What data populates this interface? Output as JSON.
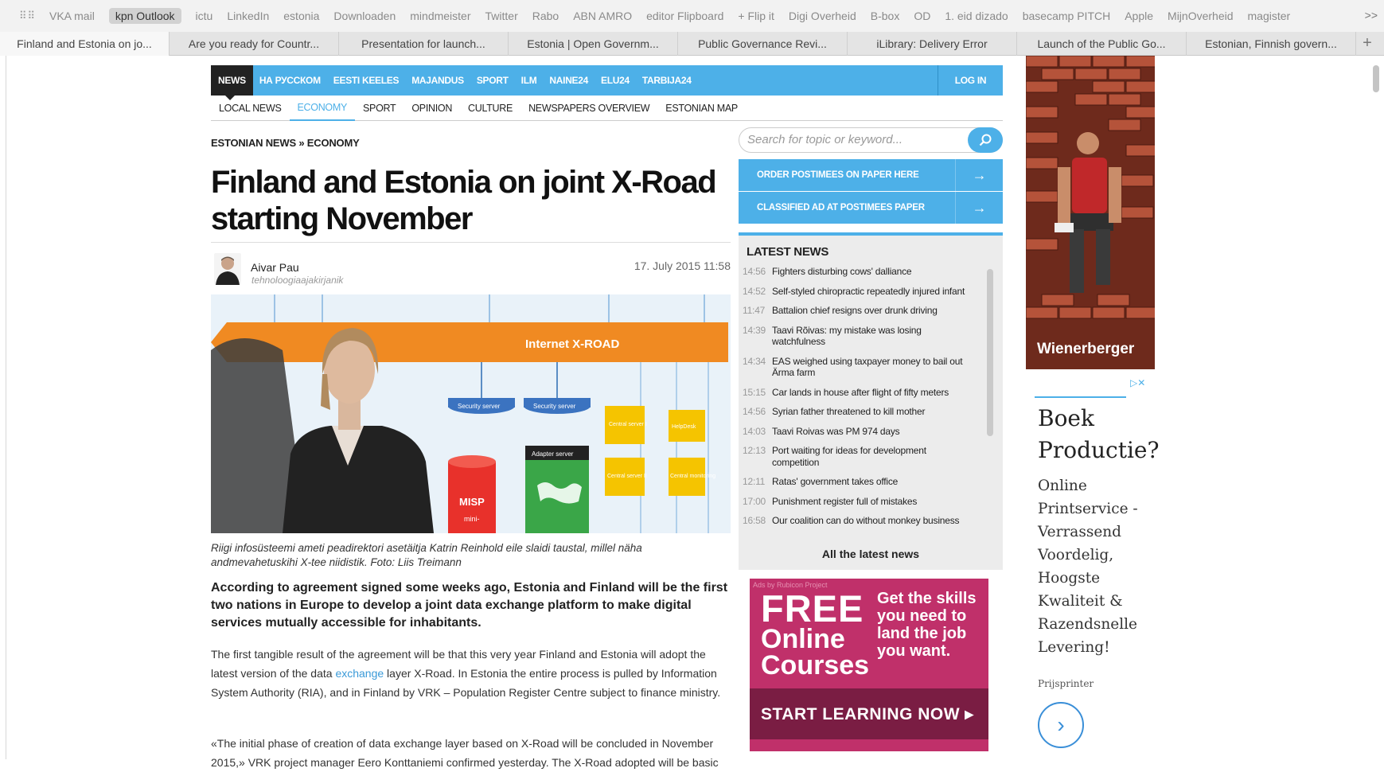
{
  "bookmarks": [
    "VKA mail",
    "kpn Outlook",
    "ictu",
    "LinkedIn",
    "estonia",
    "Downloaden",
    "mindmeister",
    "Twitter",
    "Rabo",
    "ABN AMRO",
    "editor Flipboard",
    "+ Flip it",
    "Digi Overheid",
    "B-box",
    "OD",
    "1. eid dizado",
    "basecamp PITCH",
    "Apple",
    "MijnOverheid",
    "magister"
  ],
  "bookmarks_overflow": ">>",
  "tabs": [
    "Finland and Estonia on jo...",
    "Are you ready for Countr...",
    "Presentation for launch...",
    "Estonia | Open Governm...",
    "Public Governance Revi...",
    "iLibrary: Delivery Error",
    "Launch of the Public Go...",
    "Estonian, Finnish govern..."
  ],
  "tab_add": "+",
  "topnav": {
    "items": [
      "NEWS",
      "НА РУССКОМ",
      "EESTI KEELES",
      "MAJANDUS",
      "SPORT",
      "ILM",
      "NAINE24",
      "ELU24",
      "TARBIJA24"
    ],
    "login": "LOG IN"
  },
  "subnav": [
    "LOCAL NEWS",
    "ECONOMY",
    "SPORT",
    "OPINION",
    "CULTURE",
    "NEWSPAPERS OVERVIEW",
    "ESTONIAN MAP"
  ],
  "breadcrumb": "ESTONIAN NEWS » ECONOMY",
  "article": {
    "title": "Finland and Estonia on joint X-Road starting November",
    "author": "Aivar Pau",
    "author_role": "tehnoloogiaajakirjanik",
    "date": "17. July 2015 11:58",
    "caption": "Riigi infosüsteemi ameti peadirektori asetäitja Katrin Reinhold eile slaidi taustal, millel näha andmevahetuskihi X-tee niidistik. Foto: Liis Treimann",
    "lead": "According to agreement signed some weeks ago, Estonia and Finland will be the first two nations in Europe to develop a joint data exchange platform to make digital services mutually accessible for inhabitants.",
    "p1_a": "The first tangible result of the agreement will be that this very year Finland and Estonia will adopt the latest version of the data ",
    "p1_link": "exchange",
    "p1_b": " layer X-Road. In Estonia the entire process is pulled by Information System Authority (RIA), and in Finland by VRK – Population Register Centre subject to finance ministry.",
    "p2": "«The initial phase of creation of data exchange layer based on X-Road will be concluded in November 2015,» VRK project manager Eero Konttaniemi confirmed yesterday. The X-Road adopted will be basic"
  },
  "hero_labels": {
    "banner": "Internet X-ROAD",
    "security1": "Security server",
    "security2": "Security server",
    "adapter": "Adapter server",
    "misp": "MISP",
    "mini": "mini-",
    "central1": "Central server I",
    "helpdesk": "HelpDesk",
    "central2": "Central server II",
    "monitoring": "Central monitoring"
  },
  "search": {
    "placeholder": "Search for topic or keyword..."
  },
  "cta": [
    "ORDER POSTIMEES ON PAPER HERE",
    "CLASSIFIED AD AT POSTIMEES PAPER"
  ],
  "latest": {
    "heading": "LATEST NEWS",
    "items": [
      {
        "time": "14:56",
        "text": "Fighters disturbing cows' dalliance"
      },
      {
        "time": "14:52",
        "text": "Self-styled chiropractic repeatedly injured infant"
      },
      {
        "time": "11:47",
        "text": "Battalion chief resigns over drunk driving"
      },
      {
        "time": "14:39",
        "text": "Taavi Rõivas: my mistake was losing watchfulness"
      },
      {
        "time": "14:34",
        "text": "EAS weighed using taxpayer money to bail out Ärma farm"
      },
      {
        "time": "15:15",
        "text": "Car lands in house after flight of fifty meters"
      },
      {
        "time": "14:56",
        "text": "Syrian father threatened to kill mother"
      },
      {
        "time": "14:03",
        "text": "Taavi Roivas was PM 974 days"
      },
      {
        "time": "12:13",
        "text": "Port waiting for ideas for development competition"
      },
      {
        "time": "12:11",
        "text": "Ratas' government takes office"
      },
      {
        "time": "17:00",
        "text": "Punishment register full of mistakes"
      },
      {
        "time": "16:58",
        "text": "Our coalition can do without monkey business"
      }
    ],
    "all": "All the latest news"
  },
  "ad_courses": {
    "small": "Ads by Rubicon Project",
    "free": "FREE",
    "online": "Online",
    "courses": "Courses",
    "skills": "Get the skills you need to land the job you want.",
    "cta": "START LEARNING NOW ▸"
  },
  "ad_wienerberger": {
    "brand": "Wienerberger"
  },
  "ad_text": {
    "choices": "▷✕",
    "heading": "Boek Productie?",
    "body": "Online Printservice - Verrassend Voordelig, Hoogste Kwaliteit & Razendsnelle Levering!",
    "source": "Prijsprinter"
  },
  "colors": {
    "accent": "#4db0e8",
    "ad_pink": "#c0306a"
  }
}
